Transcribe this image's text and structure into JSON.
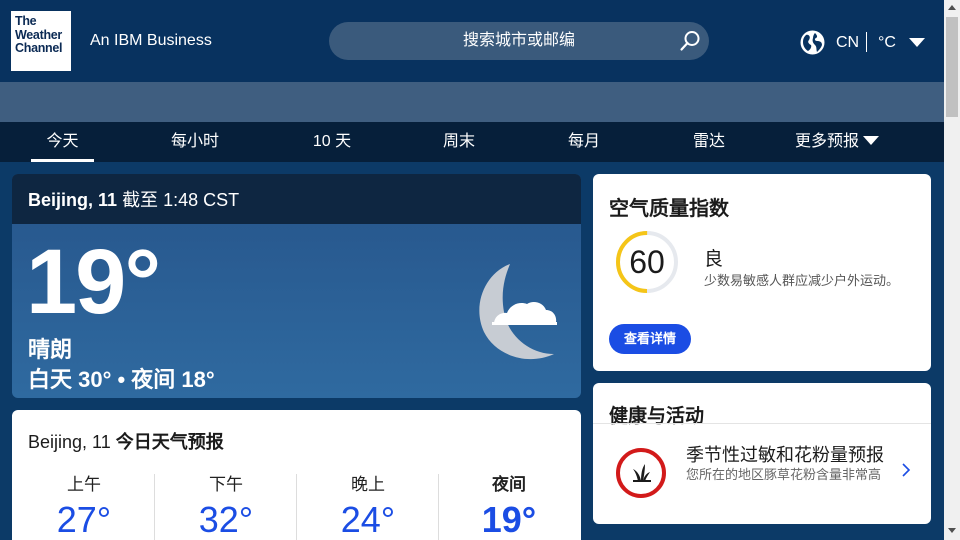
{
  "header": {
    "logo_lines": [
      "The",
      "Weather",
      "Channel"
    ],
    "ibm_text": "An IBM Business",
    "search_placeholder": "搜索城市或邮编",
    "region": "CN",
    "unit": "°C"
  },
  "nav": {
    "items": [
      {
        "label": "今天"
      },
      {
        "label": "每小时"
      },
      {
        "label": "10 天"
      },
      {
        "label": "周末"
      },
      {
        "label": "每月"
      },
      {
        "label": "雷达"
      },
      {
        "label": "更多预报"
      }
    ]
  },
  "current": {
    "location": "Beijing, 11",
    "as_of": "截至 1:48 CST",
    "temp": "19°",
    "condition": "晴朗",
    "hilo": "白天 30° • 夜间 18°"
  },
  "today_forecast": {
    "location": "Beijing, 11",
    "title": "今日天气预报",
    "columns": [
      {
        "label": "上午",
        "temp": "27°"
      },
      {
        "label": "下午",
        "temp": "32°"
      },
      {
        "label": "晚上",
        "temp": "24°"
      },
      {
        "label": "夜间",
        "temp": "19°"
      }
    ]
  },
  "aqi": {
    "title": "空气质量指数",
    "value": "60",
    "category": "良",
    "description": "少数易敏感人群应减少户外运动。",
    "button": "查看详情",
    "ring_color": "#f5c518"
  },
  "health": {
    "title": "健康与活动",
    "headline": "季节性过敏和花粉量预报",
    "description": "您所在的地区豚草花粉含量非常高"
  }
}
